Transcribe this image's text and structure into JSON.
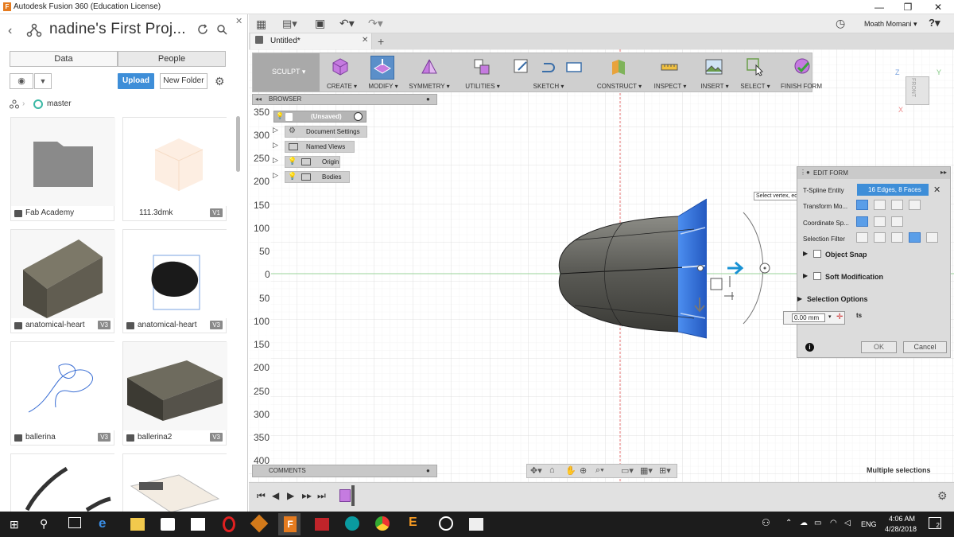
{
  "window": {
    "title": "Autodesk Fusion 360 (Education License)",
    "minimize": "—",
    "maximize": "❐",
    "close": "✕"
  },
  "left_panel": {
    "project_title": "nadine's First Proj...",
    "tabs": {
      "data": "Data",
      "people": "People"
    },
    "upload": "Upload",
    "new_folder": "New Folder",
    "breadcrumb": "master",
    "files": [
      {
        "name": "Fab Academy",
        "version": ""
      },
      {
        "name": "111.3dmk",
        "version": "V1"
      },
      {
        "name": "anatomical-heart",
        "version": "V3"
      },
      {
        "name": "anatomical-heart",
        "version": "V3"
      },
      {
        "name": "ballerina",
        "version": "V3"
      },
      {
        "name": "ballerina2",
        "version": "V3"
      }
    ]
  },
  "topbar": {
    "user": "Moath Momani ▾",
    "help": "?▾"
  },
  "doc_tab": {
    "title": "Untitled*",
    "close": "✕",
    "add": "+"
  },
  "ribbon": {
    "workspace": "SCULPT ▾",
    "groups": [
      "CREATE ▾",
      "MODIFY ▾",
      "SYMMETRY ▾",
      "UTILITIES ▾",
      "SKETCH ▾",
      "CONSTRUCT ▾",
      "INSPECT ▾",
      "INSERT ▾",
      "SELECT ▾",
      "FINISH FORM"
    ]
  },
  "browser": {
    "title": "BROWSER",
    "root": "(Unsaved)",
    "items": [
      "Document Settings",
      "Named Views",
      "Origin",
      "Bodies"
    ]
  },
  "comments": {
    "title": "COMMENTS"
  },
  "ruler": [
    "350",
    "300",
    "250",
    "200",
    "150",
    "100",
    "50",
    "0",
    "50",
    "100",
    "150",
    "200",
    "250",
    "300",
    "350",
    "400"
  ],
  "viewcube": {
    "face": "FRONT",
    "z": "Z",
    "y": "Y",
    "x": "X"
  },
  "tooltip": "Select vertex, edge or face. Alt Key to extrude",
  "edit_form": {
    "title": "EDIT FORM",
    "tspline_label": "T-Spline Entity",
    "selection": "16 Edges, 8 Faces",
    "transform_label": "Transform Mo...",
    "coord_label": "Coordinate Sp...",
    "filter_label": "Selection Filter",
    "object_snap": "Object Snap",
    "soft_mod": "Soft Modification",
    "sel_options": "Selection Options",
    "value": "0.00 mm",
    "value_suffix": "ts",
    "ok": "OK",
    "cancel": "Cancel"
  },
  "status": "Multiple selections",
  "taskbar": {
    "lang": "ENG",
    "time": "4:06 AM",
    "date": "4/28/2018",
    "notif": "2"
  },
  "colors": {
    "accent": "#3e8ed8",
    "selection": "#2f6fd6",
    "body": "#5f5f5a"
  }
}
